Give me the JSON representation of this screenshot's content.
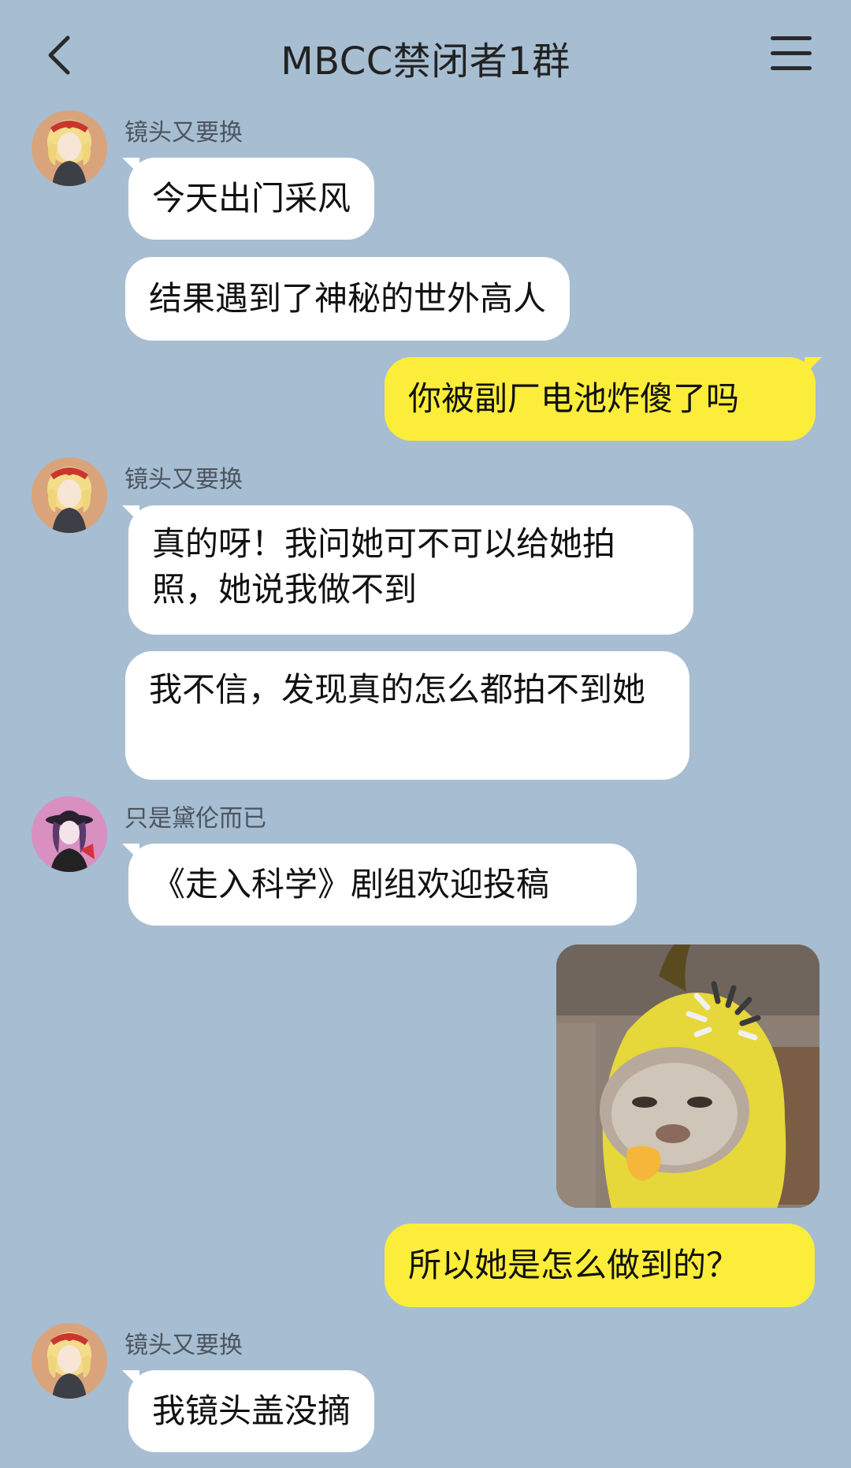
{
  "header": {
    "title": "MBCC禁闭者1群"
  },
  "messages": [
    {
      "sender": "镜头又要换",
      "text": "今天出门采风"
    },
    {
      "sender": "镜头又要换",
      "text": "结果遇到了神秘的世外高人"
    },
    {
      "sender": "me",
      "text": "你被副厂电池炸傻了吗"
    },
    {
      "sender": "镜头又要换",
      "text": "真的呀！我问她可不可以给她拍照，她说我做不到"
    },
    {
      "sender": "镜头又要换",
      "text": "我不信，发现真的怎么都拍不到她"
    },
    {
      "sender": "只是黛伦而已",
      "text": "《走入科学》剧组欢迎投稿"
    },
    {
      "sender": "me",
      "type": "sticker",
      "icon": "banana-cat-sticker"
    },
    {
      "sender": "me",
      "text": "所以她是怎么做到的？"
    },
    {
      "sender": "镜头又要换",
      "text": "我镜头盖没摘"
    }
  ],
  "colors": {
    "background": "#a7bdd1",
    "bubble_other": "#ffffff",
    "bubble_mine": "#fced3a"
  }
}
